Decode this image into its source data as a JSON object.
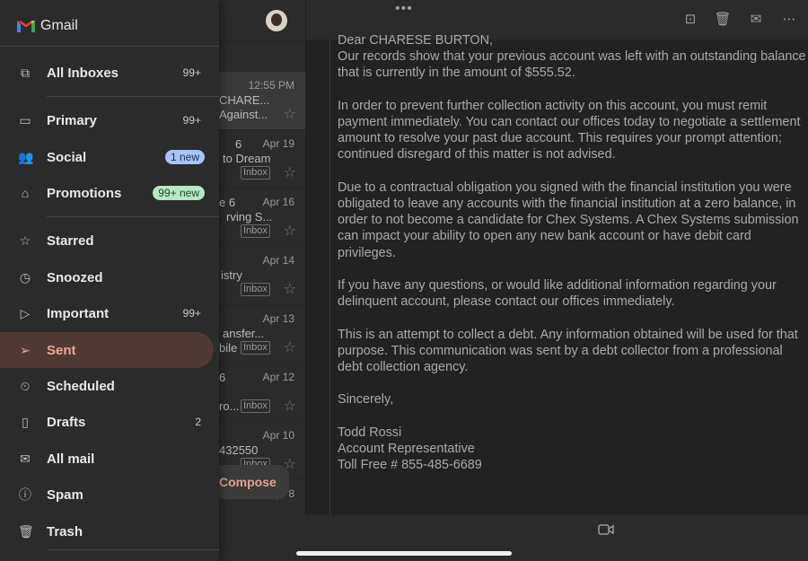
{
  "drawer": {
    "brand": "Gmail",
    "items": [
      {
        "label": "All Inboxes",
        "count": "99+"
      },
      {
        "label": "Primary",
        "count": "99+"
      },
      {
        "label": "Social",
        "pill": "1 new"
      },
      {
        "label": "Promotions",
        "pill": "99+ new"
      },
      {
        "label": "Starred",
        "count": ""
      },
      {
        "label": "Snoozed",
        "count": ""
      },
      {
        "label": "Important",
        "count": "99+"
      },
      {
        "label": "Sent",
        "count": ""
      },
      {
        "label": "Scheduled",
        "count": ""
      },
      {
        "label": "Drafts",
        "count": "2"
      },
      {
        "label": "All mail",
        "count": ""
      },
      {
        "label": "Spam",
        "count": ""
      },
      {
        "label": "Trash",
        "count": ""
      }
    ],
    "colors": {
      "accent": "#eba99a",
      "active_bg": "#4e3934",
      "social_pill": "#a7c4f5",
      "promo_pill": "#b8e6c6"
    }
  },
  "list": {
    "rows": [
      {
        "date": "12:55 PM",
        "line1": "CHARE...",
        "line2": "Against...",
        "count": "",
        "badge": ""
      },
      {
        "date": "Apr 19",
        "line1": "6",
        "line2": "to Dream",
        "count": "",
        "badge": "Inbox"
      },
      {
        "date": "Apr 16",
        "line1": "e  6",
        "line2": "rving S...",
        "count": "",
        "badge": "Inbox"
      },
      {
        "date": "Apr 14",
        "line1": "",
        "line2": "istry",
        "count": "",
        "badge": "Inbox"
      },
      {
        "date": "Apr 13",
        "line1": "ansfer...",
        "line2": "bile",
        "count": "",
        "badge": "Inbox"
      },
      {
        "date": "Apr 12",
        "line1": "6",
        "line2": "ro...",
        "count": "",
        "badge": "Inbox"
      },
      {
        "date": "Apr 10",
        "line1": "432550",
        "line2": "",
        "count": "",
        "badge": "Inbox"
      },
      {
        "date": "Apr 8",
        "line1": "",
        "line2": "",
        "count": "",
        "badge": ""
      }
    ],
    "compose": "Compose"
  },
  "email": {
    "paragraphs": [
      "Dear CHARESE BURTON,\nOur records show that your previous account was left with an outstanding balance that is currently in the amount of $555.52.",
      "In order to prevent further collection activity on this account, you must remit payment immediately. You can contact our offices today to negotiate a settlement amount to resolve your past due account. This requires your prompt attention; continued disregard of this matter is not advised.",
      "Due to a contractual obligation you signed with the financial institution you were obligated to leave any accounts with the financial institution at a zero balance, in order to not become a candidate for Chex Systems. A Chex Systems submission can impact your ability to open any new bank account or have debit card privileges.",
      "If you have any questions, or would like additional information regarding your delinquent account, please contact our offices immediately.",
      "This is an attempt to collect a debt. Any information obtained will be used for that purpose. This communication was sent by a debt collector from a professional debt collection agency.",
      "Sincerely,",
      "Todd Rossi\nAccount Representative\nToll Free # 855-485-6689"
    ]
  }
}
